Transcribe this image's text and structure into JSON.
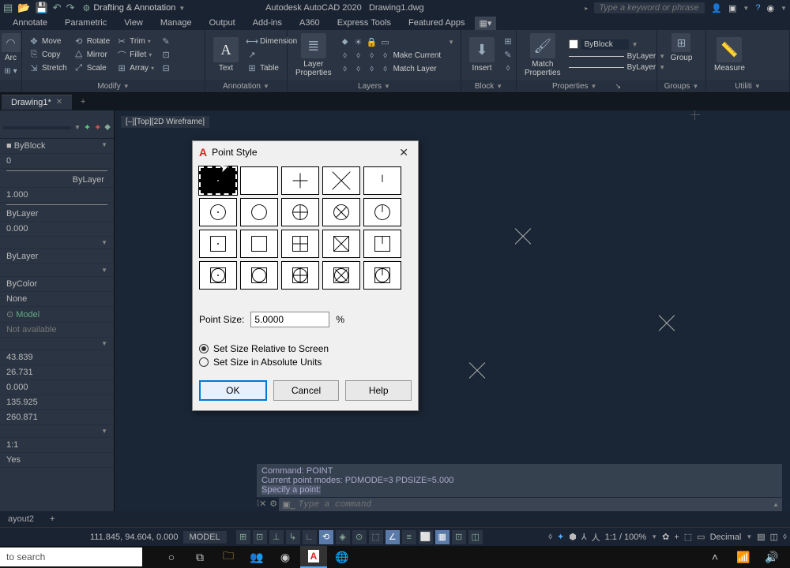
{
  "titlebar": {
    "workspace": "Drafting & Annotation",
    "app": "Autodesk AutoCAD 2020",
    "doc": "Drawing1.dwg",
    "search_ph": "Type a keyword or phrase"
  },
  "menus": [
    "Annotate",
    "Parametric",
    "View",
    "Manage",
    "Output",
    "Add-ins",
    "A360",
    "Express Tools",
    "Featured Apps"
  ],
  "ribbon": {
    "modify": {
      "label": "Modify",
      "move": "Move",
      "rotate": "Rotate",
      "trim": "Trim",
      "copy": "Copy",
      "mirror": "Mirror",
      "fillet": "Fillet",
      "stretch": "Stretch",
      "scale": "Scale",
      "array": "Array"
    },
    "annotation": {
      "label": "Annotation",
      "text": "Text",
      "dimension": "Dimension",
      "table": "Table"
    },
    "layers": {
      "label": "Layers",
      "props": "Layer\nProperties",
      "makecur": "Make Current",
      "matchlayer": "Match Layer"
    },
    "block": {
      "label": "Block",
      "insert": "Insert"
    },
    "properties": {
      "label": "Properties",
      "match": "Match\nProperties",
      "color": "ByBlock",
      "line1": "ByLayer",
      "line2": "ByLayer"
    },
    "groups": {
      "label": "Groups",
      "group": "Group"
    },
    "utilities": {
      "label": "Utilities",
      "measure": "Measure"
    }
  },
  "filetab": "Drawing1*",
  "viewport_label": "[–][Top][2D Wireframe]",
  "props": {
    "colorblock": "ByBlock",
    "zero": "0",
    "bylayer": "ByLayer",
    "val1": "1.000",
    "bylayer2": "ByLayer",
    "zero2": "0.000",
    "bylayer3": "ByLayer",
    "bycolor": "ByColor",
    "none": "None",
    "model": "Model",
    "na": "Not available",
    "c1": "43.839",
    "c2": "26.731",
    "c3": "0.000",
    "c4": "135.925",
    "c5": "260.871",
    "ratio": "1:1",
    "yes": "Yes"
  },
  "layout_tab": "ayout2",
  "cmd": {
    "l1": "Command: POINT",
    "l2": "Current point modes:  PDMODE=3  PDSIZE=5.000",
    "l3": "Specify a point:",
    "ph": "Type a command"
  },
  "status": {
    "coords": "111.845, 94.604, 0.000",
    "model": "MODEL",
    "scale": "1:1 / 100%",
    "dec": "Decimal"
  },
  "dialog": {
    "title": "Point Style",
    "size_label": "Point Size:",
    "size_val": "5.0000",
    "pct": "%",
    "opt1": "Set Size Relative to Screen",
    "opt2": "Set Size in Absolute Units",
    "ok": "OK",
    "cancel": "Cancel",
    "help": "Help"
  },
  "taskbar": {
    "search": "to search"
  }
}
